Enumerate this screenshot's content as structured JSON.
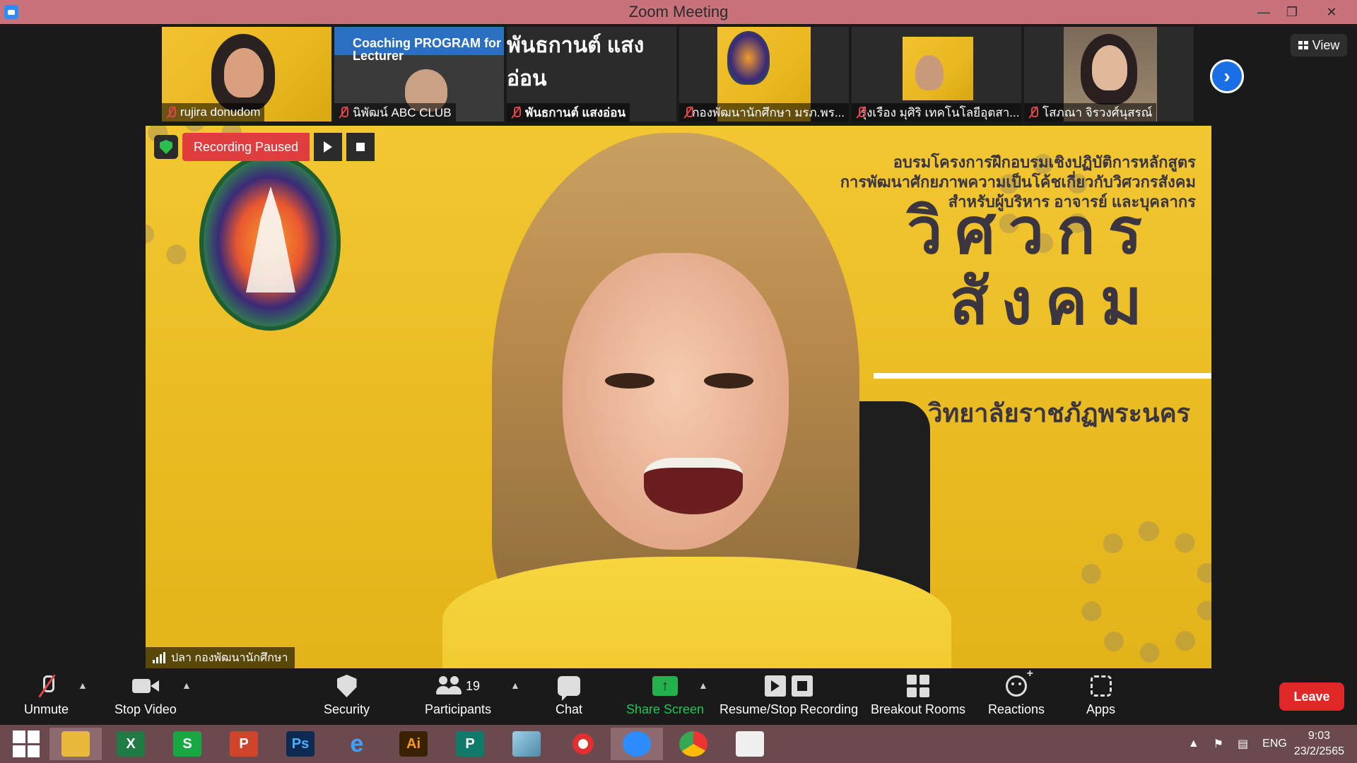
{
  "window": {
    "title": "Zoom Meeting"
  },
  "thumbnails": [
    {
      "name": "rujira donudom"
    },
    {
      "name": "นิพัฒน์ ABC CLUB",
      "banner": "Coaching PROGRAM for Lecturer"
    },
    {
      "name": "พันธกานต์ แสงอ่อน",
      "display_text": "พันธกานต์ แสงอ่อน"
    },
    {
      "name": "กองพัฒนานักศึกษา มรภ.พร..."
    },
    {
      "name": "รุ่งเรือง มุศิริ เทคโนโลยีอุตสา..."
    },
    {
      "name": "โสภณา จิรวงศ์นุสรณ์"
    }
  ],
  "view_button": {
    "label": "View"
  },
  "recording": {
    "status": "Recording Paused"
  },
  "main_video": {
    "speaker_name": "ปลา กองพัฒนานักศึกษา",
    "banner_lines": [
      "อบรมโครงการฝึกอบรมเชิงปฏิบัติการหลักสูตร",
      "การพัฒนาศักยภาพความเป็นโค้ชเกี่ยวกับวิศวกรสังคม",
      "สำหรับผู้บริหาร อาจารย์ และบุคลากร"
    ],
    "banner_big_1": "วิศวกร",
    "banner_big_2": "สังคม",
    "banner_sub": "วิทยาลัยราชภัฏพระนคร"
  },
  "toolbar": {
    "unmute": "Unmute",
    "stop_video": "Stop Video",
    "security": "Security",
    "participants": "Participants",
    "participants_count": "19",
    "chat": "Chat",
    "share_screen": "Share Screen",
    "recording": "Resume/Stop Recording",
    "breakout": "Breakout Rooms",
    "reactions": "Reactions",
    "apps": "Apps",
    "leave": "Leave"
  },
  "taskbar": {
    "apps": [
      "X",
      "S",
      "P",
      "Ps",
      "e",
      "Ai",
      "P",
      "",
      "",
      "",
      "",
      ""
    ],
    "language": "ENG",
    "time": "9:03",
    "date": "23/2/2565"
  }
}
